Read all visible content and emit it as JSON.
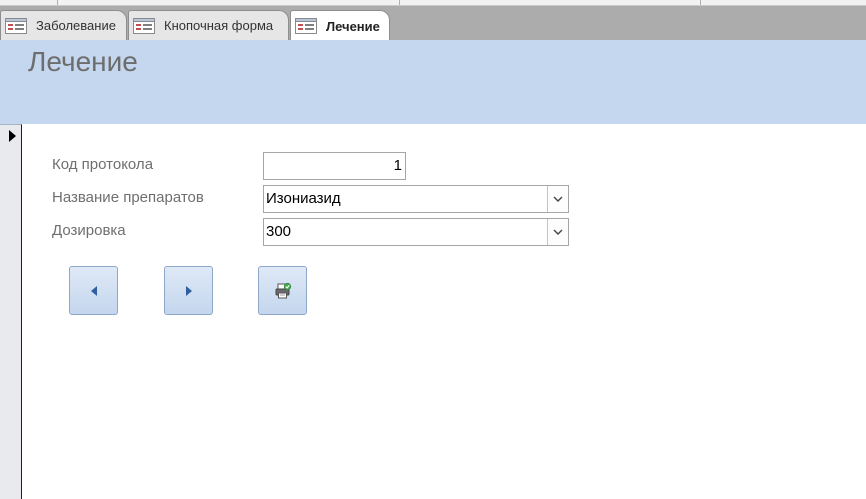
{
  "tabs": [
    {
      "label": "Заболевание",
      "active": false
    },
    {
      "label": "Кнопочная форма",
      "active": false
    },
    {
      "label": "Лечение",
      "active": true
    }
  ],
  "form": {
    "title": "Лечение",
    "fields": {
      "protocol_code": {
        "label": "Код протокола",
        "value": "1"
      },
      "drug_name": {
        "label": "Название препаратов",
        "value": "Изониазид"
      },
      "dosage": {
        "label": "Дозировка",
        "value": "300"
      }
    }
  },
  "buttons": {
    "prev": {
      "icon": "previous-record-icon"
    },
    "next": {
      "icon": "next-record-icon"
    },
    "print": {
      "icon": "print-icon"
    }
  },
  "colors": {
    "header_band": "#c5d7ef",
    "tab_bar": "#acacac",
    "button_gradient_top": "#dfe9f6",
    "button_gradient_bottom": "#c4d6ee"
  }
}
